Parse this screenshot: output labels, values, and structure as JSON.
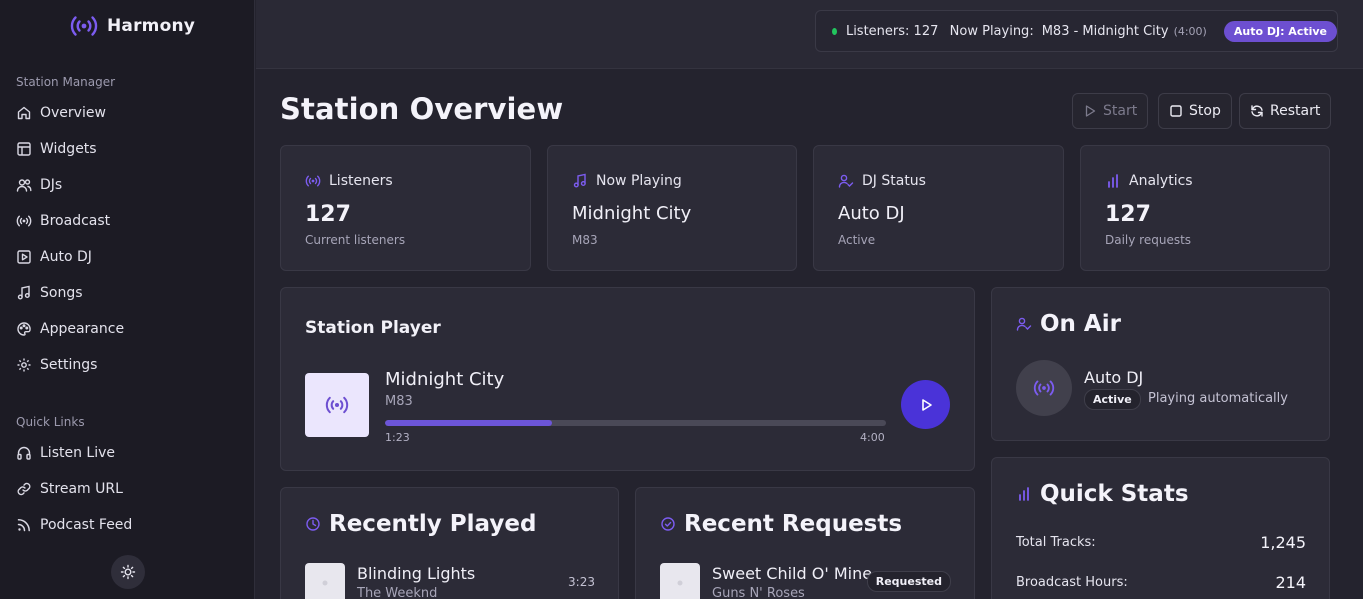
{
  "app": {
    "name": "Harmony"
  },
  "sidebar": {
    "section_manager": "Station Manager",
    "items": [
      {
        "label": "Overview",
        "icon": "home-icon"
      },
      {
        "label": "Widgets",
        "icon": "layout-icon"
      },
      {
        "label": "DJs",
        "icon": "users-icon"
      },
      {
        "label": "Broadcast",
        "icon": "broadcast-icon"
      },
      {
        "label": "Auto DJ",
        "icon": "play-square-icon"
      },
      {
        "label": "Songs",
        "icon": "music-icon"
      },
      {
        "label": "Appearance",
        "icon": "palette-icon"
      },
      {
        "label": "Settings",
        "icon": "gear-icon"
      }
    ],
    "section_links": "Quick Links",
    "links": [
      {
        "label": "Listen Live",
        "icon": "headphones-icon"
      },
      {
        "label": "Stream URL",
        "icon": "link-icon"
      },
      {
        "label": "Podcast Feed",
        "icon": "rss-icon"
      }
    ]
  },
  "topbar": {
    "listeners": "Listeners: 127",
    "now_playing_label": "Now Playing:",
    "now_playing_track": "M83 - Midnight City",
    "now_playing_duration": "(4:00)",
    "auto_dj_badge": "Auto DJ: Active"
  },
  "page": {
    "title": "Station Overview"
  },
  "controls": {
    "start": "Start",
    "stop": "Stop",
    "restart": "Restart"
  },
  "stats": [
    {
      "label": "Listeners",
      "value": "127",
      "sub": "Current listeners"
    },
    {
      "label": "Now Playing",
      "value": "Midnight City",
      "sub": "M83"
    },
    {
      "label": "DJ Status",
      "value": "Auto DJ",
      "sub": "Active"
    },
    {
      "label": "Analytics",
      "value": "127",
      "sub": "Daily requests"
    }
  ],
  "player": {
    "title": "Station Player",
    "track": "Midnight City",
    "artist": "M83",
    "elapsed": "1:23",
    "duration": "4:00",
    "progress_fraction": 0.333
  },
  "on_air": {
    "title": "On Air",
    "name": "Auto DJ",
    "badge": "Active",
    "desc": "Playing automatically"
  },
  "quick_stats": {
    "title": "Quick Stats",
    "rows": [
      {
        "label": "Total Tracks:",
        "value": "1,245"
      },
      {
        "label": "Broadcast Hours:",
        "value": "214"
      }
    ]
  },
  "recently_played": {
    "title": "Recently Played",
    "items": [
      {
        "title": "Blinding Lights",
        "artist": "The Weeknd",
        "time": "3:23"
      }
    ]
  },
  "recent_requests": {
    "title": "Recent Requests",
    "items": [
      {
        "title": "Sweet Child O' Mine",
        "artist": "Guns N' Roses",
        "badge": "Requested"
      }
    ]
  },
  "colors": {
    "accent": "#6d4fd1",
    "play_button": "#4a33d8",
    "status_dot": "#22c55e"
  }
}
